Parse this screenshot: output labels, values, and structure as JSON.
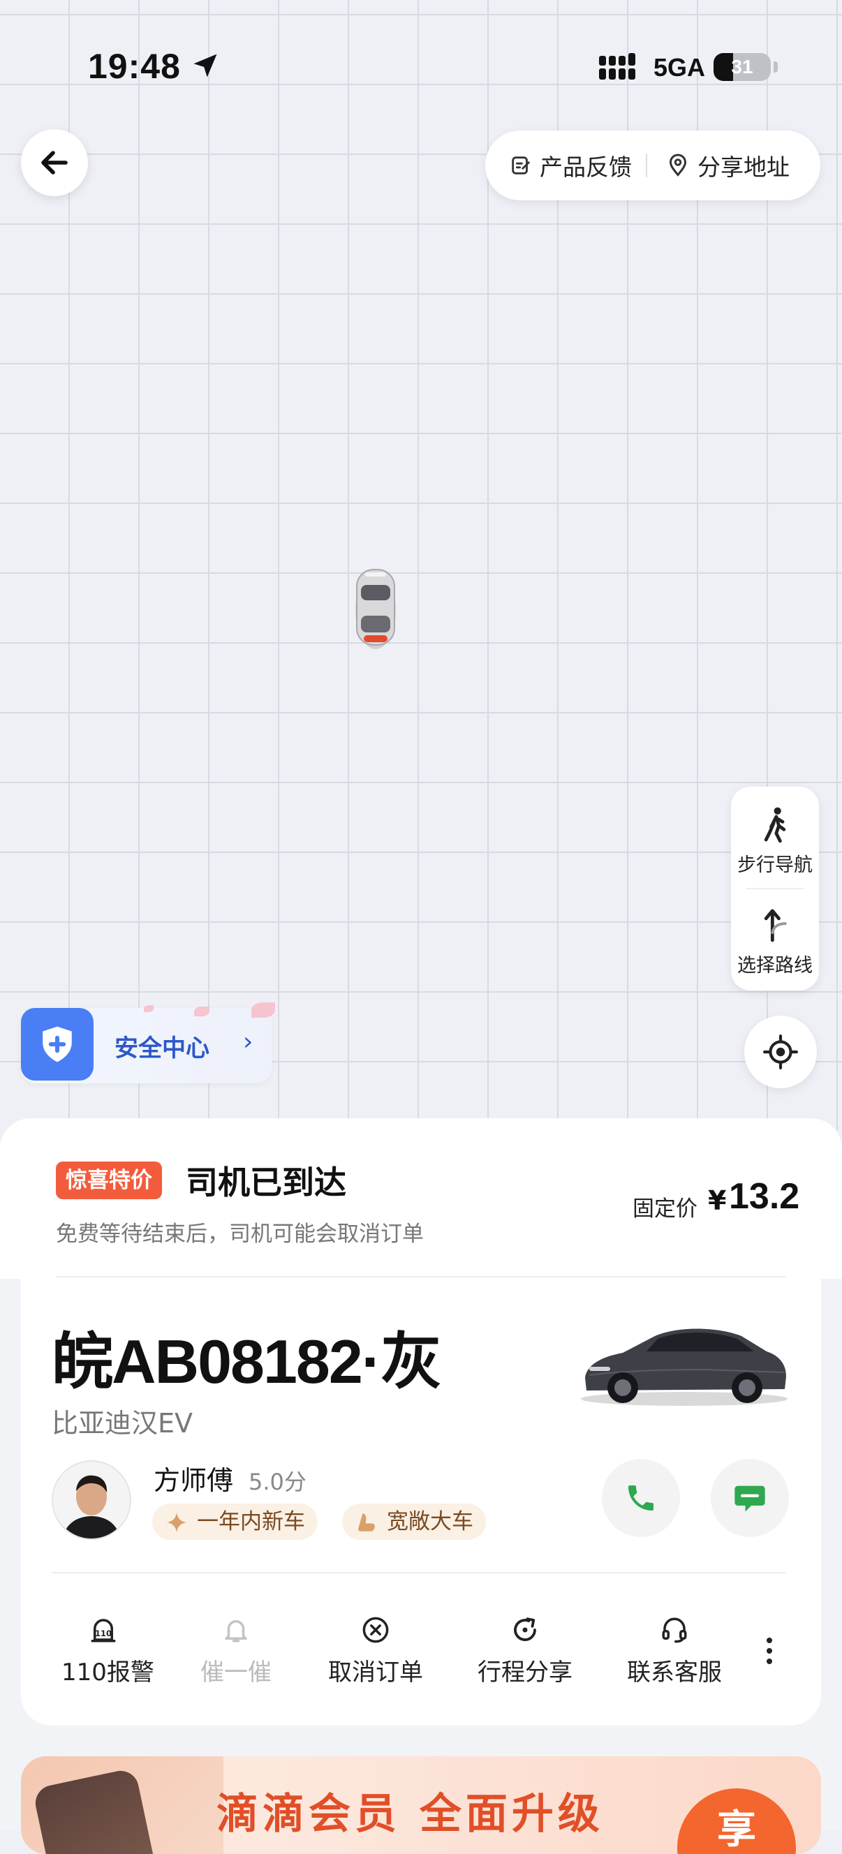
{
  "status_bar": {
    "time": "19:48",
    "network": "5GA",
    "battery": "31"
  },
  "top_actions": {
    "feedback": "产品反馈",
    "share_address": "分享地址"
  },
  "map_controls": {
    "walk_nav": "步行导航",
    "choose_route": "选择路线"
  },
  "safety": {
    "label": "安全中心"
  },
  "trip_status": {
    "badge": "惊喜特价",
    "title": "司机已到达",
    "subtitle": "免费等待结束后，司机可能会取消订单",
    "price_label": "固定价",
    "currency": "¥",
    "price": "13.2"
  },
  "vehicle": {
    "plate": "皖AB08182·灰",
    "model": "比亚迪汉EV"
  },
  "driver": {
    "name": "方师傅",
    "rating": "5.0分",
    "tags": [
      "一年内新车",
      "宽敞大车"
    ]
  },
  "actions": [
    {
      "label": "110报警",
      "enabled": true
    },
    {
      "label": "催一催",
      "enabled": false
    },
    {
      "label": "取消订单",
      "enabled": true
    },
    {
      "label": "行程分享",
      "enabled": true
    },
    {
      "label": "联系客服",
      "enabled": true
    }
  ],
  "promo_banner": {
    "text": "滴滴会员 全面升级",
    "button": "享"
  },
  "colors": {
    "accent_orange": "#f25c3c",
    "safety_blue": "#4a7ef5",
    "call_green": "#2fa84f"
  }
}
